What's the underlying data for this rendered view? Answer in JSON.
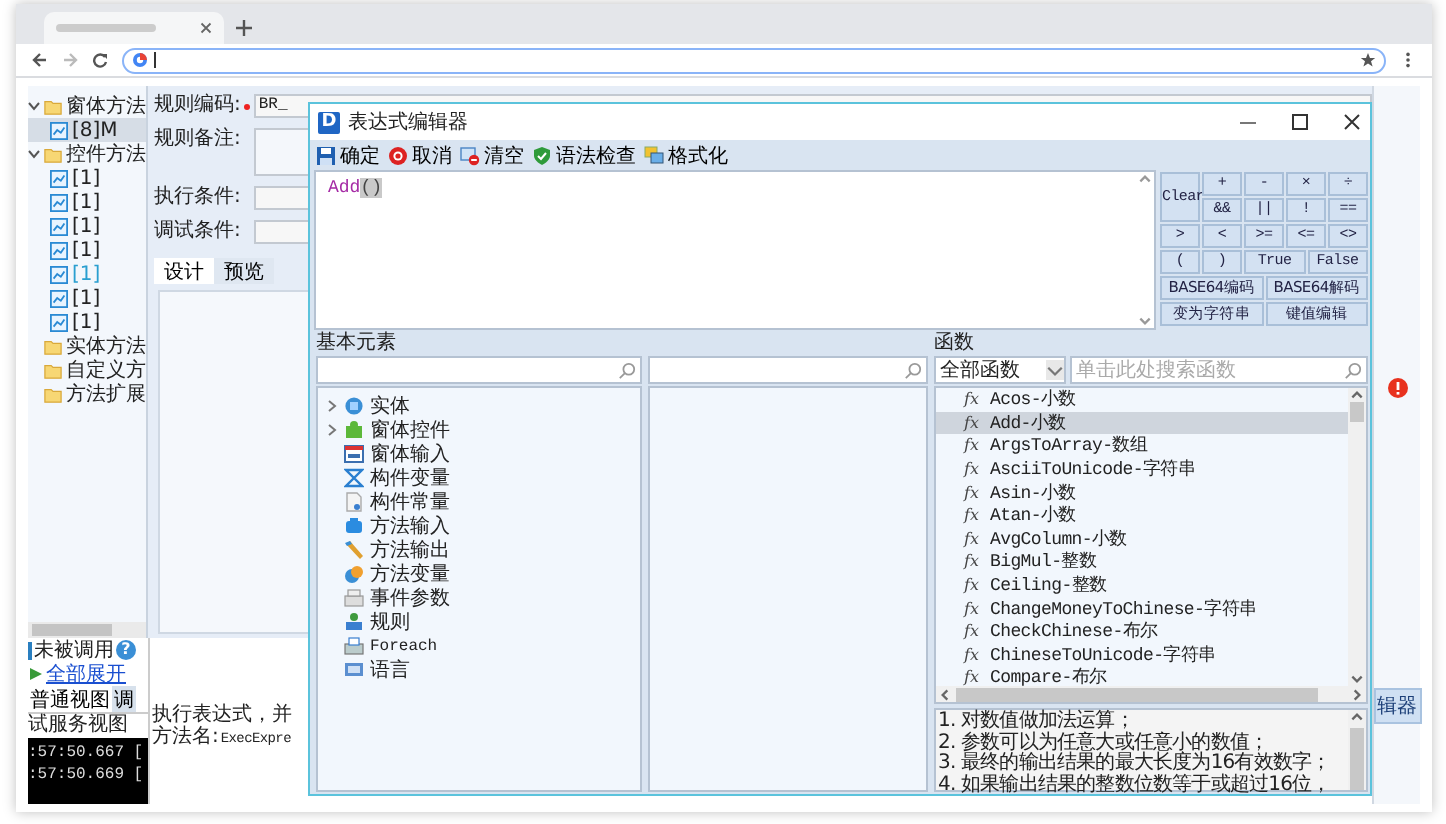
{
  "tree": [
    {
      "label": "窗体方法",
      "kind": "folder",
      "expanded": true,
      "children": [
        {
          "label": "[8]M",
          "kind": "rule",
          "selected": true,
          "highlighted": false
        }
      ]
    },
    {
      "label": "控件方法",
      "kind": "folder",
      "expanded": true,
      "children": [
        {
          "label": "[1]",
          "kind": "rule",
          "selected": false,
          "highlighted": false
        },
        {
          "label": "[1]",
          "kind": "rule",
          "selected": false,
          "highlighted": false
        },
        {
          "label": "[1]",
          "kind": "rule",
          "selected": false,
          "highlighted": false
        },
        {
          "label": "[1]",
          "kind": "rule",
          "selected": false,
          "highlighted": false
        },
        {
          "label": "[1]",
          "kind": "rule",
          "selected": false,
          "highlighted": true
        },
        {
          "label": "[1]",
          "kind": "rule",
          "selected": false,
          "highlighted": false
        },
        {
          "label": "[1]",
          "kind": "rule",
          "selected": false,
          "highlighted": false
        }
      ]
    },
    {
      "label": "实体方法",
      "kind": "folder"
    },
    {
      "label": "自定义方",
      "kind": "folder"
    },
    {
      "label": "方法扩展",
      "kind": "folder"
    }
  ],
  "form": {
    "fields": [
      {
        "label": "规则编码:",
        "required": true,
        "kind": "input",
        "value": "BR_"
      },
      {
        "label": "规则备注:",
        "required": false,
        "kind": "textarea"
      },
      {
        "label": "执行条件:",
        "required": false,
        "kind": "input"
      },
      {
        "label": "调试条件:",
        "required": false,
        "kind": "input"
      }
    ],
    "tabs": [
      {
        "label": "设计",
        "selected": true
      },
      {
        "label": "预览",
        "selected": false
      }
    ]
  },
  "status": {
    "unused_label": "未被调用",
    "help": "?",
    "expand_all": "全部展开",
    "view_tabs": [
      {
        "label": "普通视图",
        "selected": true
      },
      {
        "label": "调",
        "selected": false
      }
    ],
    "service_view": "试服务视图",
    "log": [
      ":57:50.667 [",
      ":57:50.669 ["
    ],
    "message": "执行表达式，并",
    "method_label": "方法名:",
    "method": "ExecExpre"
  },
  "side_button": "辑器",
  "dialog": {
    "logo": "D",
    "title": "表达式编辑器",
    "toolbar": [
      {
        "label": "确定"
      },
      {
        "label": "取消"
      },
      {
        "label": "清空"
      },
      {
        "label": "语法检查"
      },
      {
        "label": "格式化"
      }
    ],
    "expression": [
      {
        "text": "Add",
        "kind": "function"
      },
      {
        "text": "()",
        "kind": "bracket"
      }
    ],
    "keypad": [
      {
        "label": "Clear",
        "kind": "clear"
      },
      {
        "label": "+",
        "kind": "op"
      },
      {
        "label": "-",
        "kind": "op"
      },
      {
        "label": "×",
        "kind": "op"
      },
      {
        "label": "÷",
        "kind": "op"
      },
      {
        "label": "&&",
        "kind": "op"
      },
      {
        "label": "||",
        "kind": "op"
      },
      {
        "label": "!",
        "kind": "op"
      },
      {
        "label": "==",
        "kind": "op"
      },
      {
        "label": ">",
        "kind": "op"
      },
      {
        "label": "<",
        "kind": "op"
      },
      {
        "label": ">=",
        "kind": "op"
      },
      {
        "label": "<=",
        "kind": "op"
      },
      {
        "label": "<>",
        "kind": "op"
      },
      {
        "label": "(",
        "kind": "op"
      },
      {
        "label": ")",
        "kind": "op"
      },
      {
        "label": "True",
        "kind": "wide"
      },
      {
        "label": "False",
        "kind": "wide"
      },
      {
        "label": "BASE64编码",
        "kind": "half"
      },
      {
        "label": "BASE64解码",
        "kind": "half"
      },
      {
        "label": "变为字符串",
        "kind": "half"
      },
      {
        "label": "键值编辑",
        "kind": "half"
      }
    ],
    "elements": {
      "title": "基本元素",
      "items": [
        {
          "label": "实体",
          "has_children": true
        },
        {
          "label": "窗体控件",
          "has_children": true
        },
        {
          "label": "窗体输入",
          "has_children": false
        },
        {
          "label": "构件变量",
          "has_children": false
        },
        {
          "label": "构件常量",
          "has_children": false
        },
        {
          "label": "方法输入",
          "has_children": false
        },
        {
          "label": "方法输出",
          "has_children": false
        },
        {
          "label": "方法变量",
          "has_children": false
        },
        {
          "label": "事件参数",
          "has_children": false
        },
        {
          "label": "规则",
          "has_children": false
        },
        {
          "label": "Foreach",
          "has_children": false
        },
        {
          "label": "语言",
          "has_children": false
        }
      ]
    },
    "functions": {
      "title": "函数",
      "category": "全部函数",
      "search_placeholder": "单击此处搜索函数",
      "items": [
        {
          "icon": "fx",
          "name": "Acos-小数",
          "selected": false
        },
        {
          "icon": "fx",
          "name": "Add-小数",
          "selected": true
        },
        {
          "icon": "fx",
          "name": "ArgsToArray-数组",
          "selected": false
        },
        {
          "icon": "fx",
          "name": "AsciiToUnicode-字符串",
          "selected": false
        },
        {
          "icon": "fx",
          "name": "Asin-小数",
          "selected": false
        },
        {
          "icon": "fx",
          "name": "Atan-小数",
          "selected": false
        },
        {
          "icon": "fx",
          "name": "AvgColumn-小数",
          "selected": false
        },
        {
          "icon": "fx",
          "name": "BigMul-整数",
          "selected": false
        },
        {
          "icon": "fx",
          "name": "Ceiling-整数",
          "selected": false
        },
        {
          "icon": "fx",
          "name": "ChangeMoneyToChinese-字符串",
          "selected": false
        },
        {
          "icon": "fx",
          "name": "CheckChinese-布尔",
          "selected": false
        },
        {
          "icon": "fx",
          "name": "ChineseToUnicode-字符串",
          "selected": false
        },
        {
          "icon": "fx",
          "name": "Compare-布尔",
          "selected": false
        }
      ],
      "description": [
        "1. 对数值做加法运算；",
        "2. 参数可以为任意大或任意小的数值；",
        "3. 最终的输出结果的最大长度为16有效数字；",
        "4. 如果输出结果的整数位数等于或超过16位，"
      ]
    }
  }
}
